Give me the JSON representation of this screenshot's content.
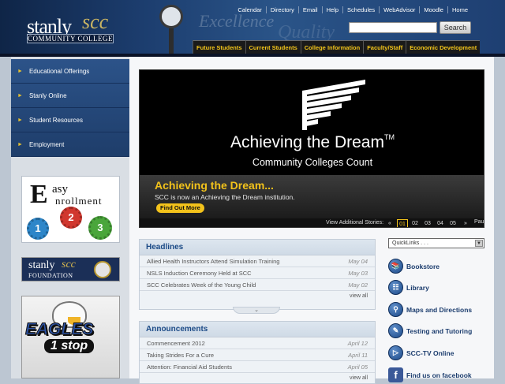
{
  "header": {
    "logo_stanly": "stanly",
    "logo_scc": "scc",
    "logo_cc": "COMMUNITY COLLEGE",
    "motto_1": "Excellence",
    "motto_2": "Quality",
    "utility_nav": [
      "Calendar",
      "Directory",
      "Email",
      "Help",
      "Schedules",
      "WebAdvisor",
      "Moodle",
      "Home"
    ],
    "search": {
      "placeholder": "",
      "button_label": "Search"
    },
    "main_tabs": [
      "Future Students",
      "Current Students",
      "College Information",
      "Faculty/Staff",
      "Economic Development"
    ]
  },
  "left_nav": {
    "items": [
      "Educational Offerings",
      "Stanly Online",
      "Student Resources",
      "Employment"
    ],
    "arrow": "►"
  },
  "promos": {
    "easy_enrollment": {
      "e": "E",
      "asy": "asy",
      "nroll": "nrollment",
      "gears": [
        "1",
        "2",
        "3"
      ]
    },
    "foundation": {
      "stanly": "stanly",
      "scc": "scc",
      "text": "FOUNDATION"
    },
    "eagles": {
      "title": "EAGLES",
      "subtitle": "1 stop"
    }
  },
  "slideshow": {
    "title": "Achieving the Dream",
    "tm": "TM",
    "subtitle": "Community Colleges Count",
    "caption_title": "Achieving the Dream...",
    "caption_desc": "SCC is now an Achieving the Dream institution.",
    "cta_label": "Find Out More",
    "controls_label": "View Additional Stories:",
    "prev": "«",
    "numbers": [
      "01",
      "02",
      "03",
      "04",
      "05"
    ],
    "active_index": 0,
    "next": "»",
    "pause": "Pause"
  },
  "headlines": {
    "title": "Headlines",
    "items": [
      {
        "text": "Allied Health Instructors Attend Simulation Training",
        "date": "May 04"
      },
      {
        "text": "NSLS Induction Ceremony Held at SCC",
        "date": "May 03"
      },
      {
        "text": "SCC Celebrates Week of the Young Child",
        "date": "May 02"
      }
    ],
    "view_all": "view all"
  },
  "announcements": {
    "title": "Announcements",
    "items": [
      {
        "text": "Commencement 2012",
        "date": "April 12"
      },
      {
        "text": "Taking Strides For a Cure",
        "date": "April 11"
      },
      {
        "text": "Attention: Financial Aid Students",
        "date": "April 05"
      }
    ],
    "view_all": "view all"
  },
  "quick_links": {
    "select_value": "QuickLinks . . .",
    "links": [
      {
        "label": "Bookstore",
        "icon": "bookstore-icon"
      },
      {
        "label": "Library",
        "icon": "library-icon"
      },
      {
        "label": "Maps and Directions",
        "icon": "map-icon"
      },
      {
        "label": "Testing and Tutoring",
        "icon": "testing-icon"
      },
      {
        "label": "SCC-TV Online",
        "icon": "tv-icon"
      },
      {
        "label": "Find us on facebook",
        "icon": "facebook-icon"
      }
    ]
  },
  "colors": {
    "header_blue": "#1c3d6e",
    "accent_yellow": "#f2c21b",
    "link_blue": "#1b4a86"
  }
}
